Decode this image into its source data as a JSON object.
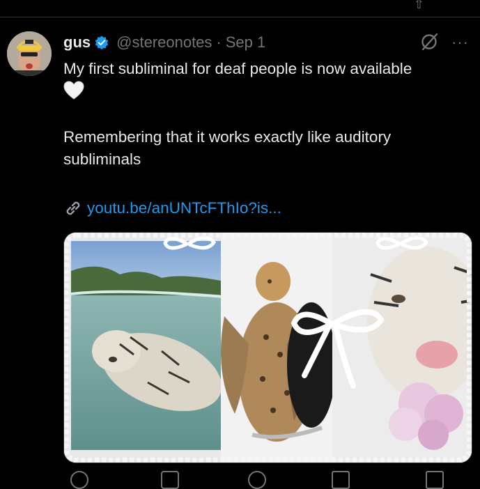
{
  "tweet": {
    "author_name": "gus",
    "verified": true,
    "handle": "@stereonotes",
    "separator": "·",
    "date": "Sep 1",
    "text_line1": "My first subliminal for deaf people is now available",
    "text_line2": "Remembering that it works exactly like auditory",
    "text_line3": "subliminals",
    "link_text": "youtu.be/anUNTcFThIo?is..."
  },
  "icons": {
    "verified": "verified-badge-icon",
    "grok": "grok-icon",
    "more": "more-icon",
    "heart": "white-heart-emoji",
    "link": "link-icon",
    "share": "share-icon"
  },
  "more_label": "···",
  "colors": {
    "background": "#000000",
    "text": "#e7e9ea",
    "secondary": "#71767b",
    "link": "#1d9bf0",
    "verified": "#1d9bf0",
    "divider": "#2f3336"
  },
  "media": {
    "description_icons": [
      "white-tiger-underwater",
      "leopards-with-wings",
      "white-ribbon-bow",
      "white-tiger-face-with-flowers"
    ]
  }
}
